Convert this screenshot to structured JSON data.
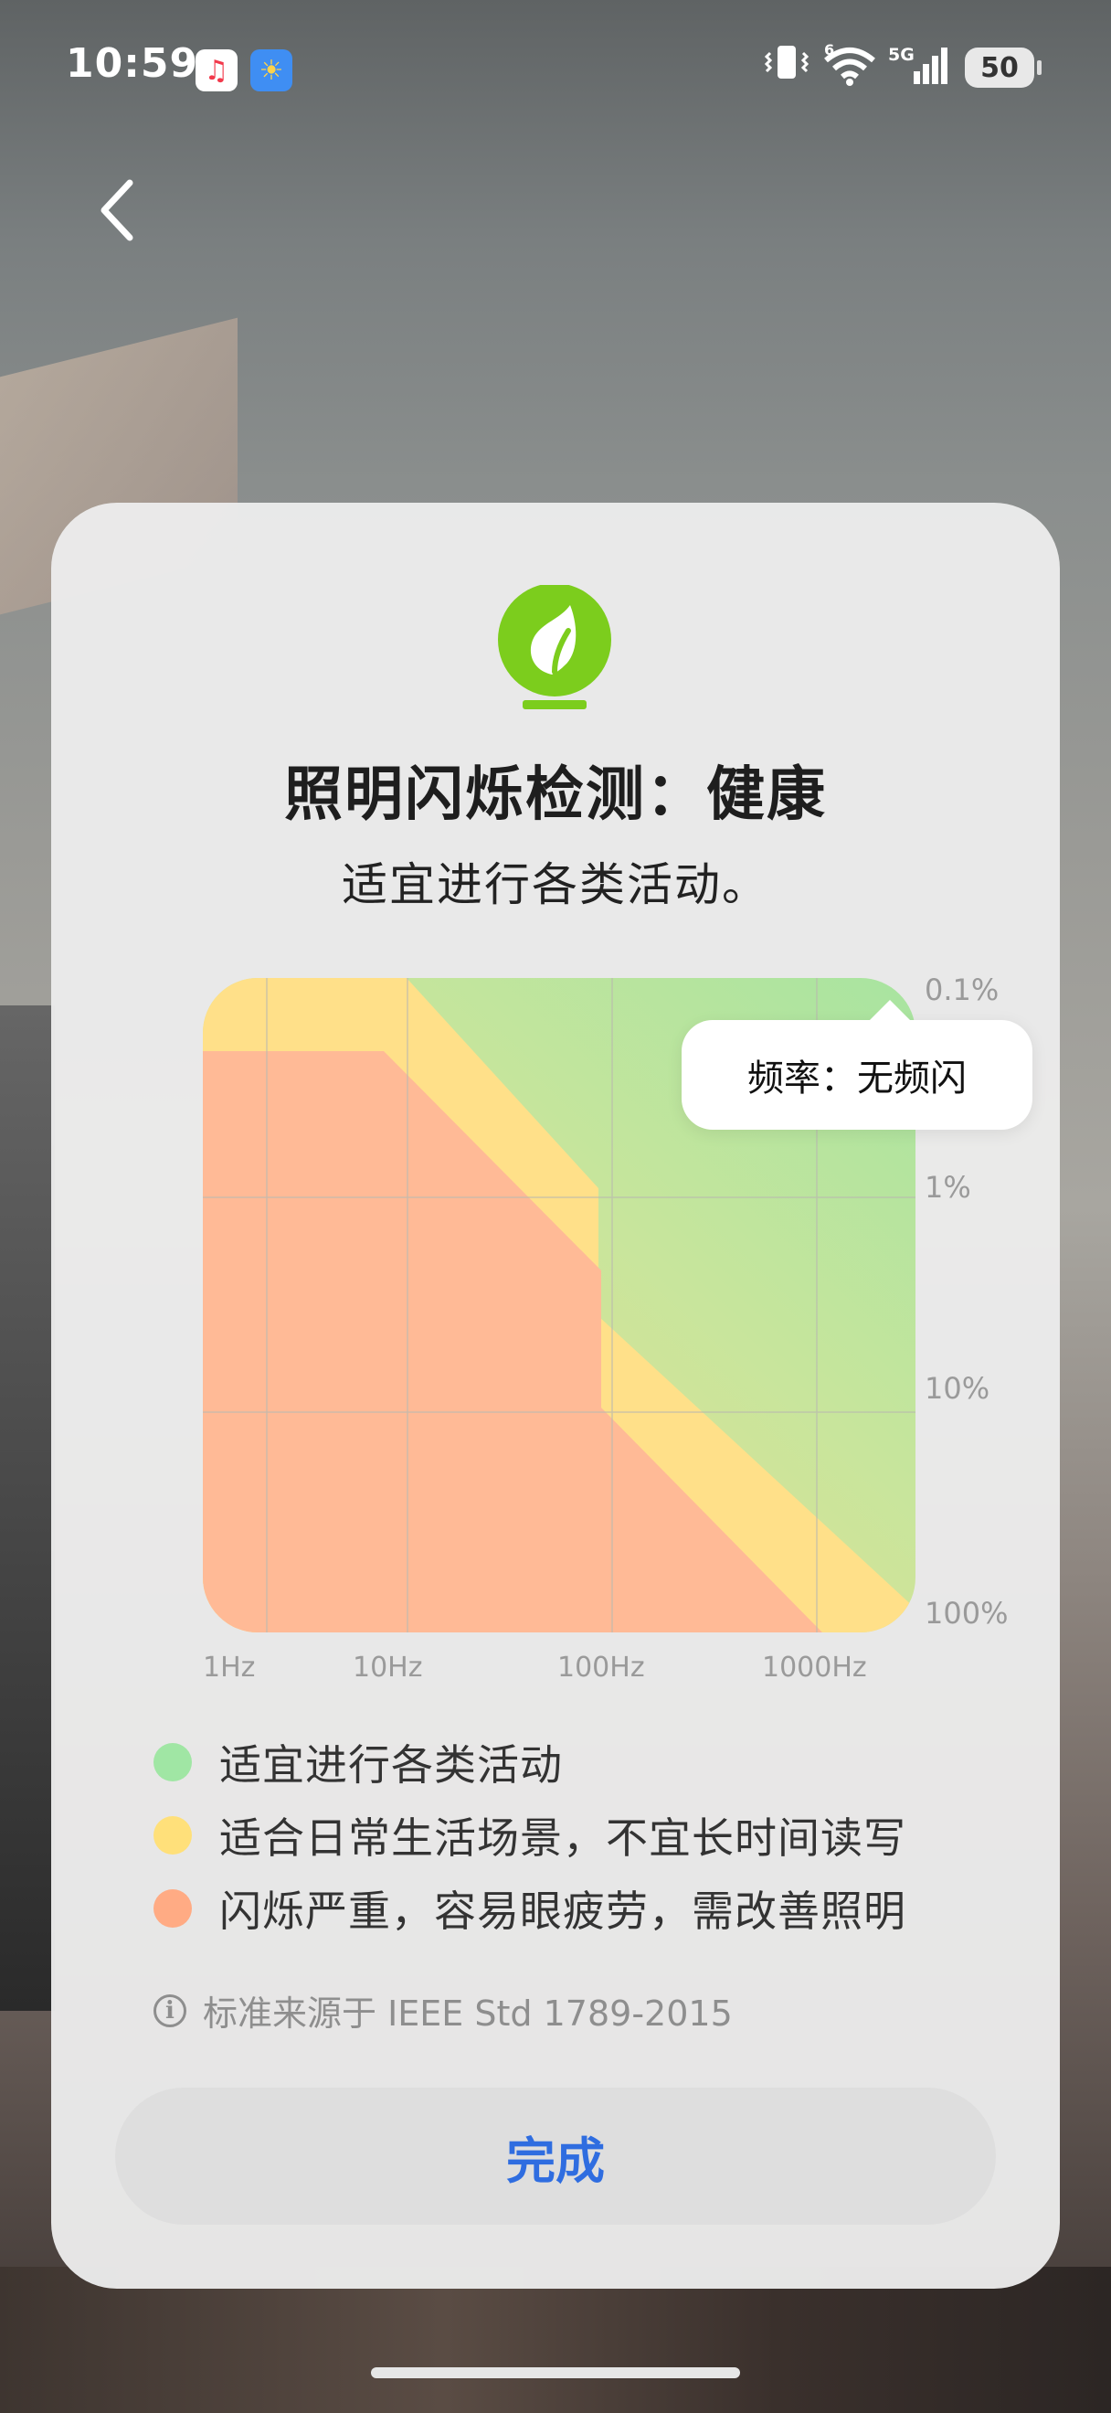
{
  "status_bar": {
    "time": "10:59",
    "app_icons": [
      "music-app-icon",
      "weather-app-icon"
    ],
    "system_icons": [
      "vibrate-icon",
      "wifi-icon",
      "5g-signal-icon"
    ],
    "network": "5G",
    "wifi_badge": "6",
    "battery": "50"
  },
  "header": {
    "back_icon": "chevron-left-icon"
  },
  "card": {
    "icon": "leaf-bulb-icon",
    "icon_color": "#7ccd1d",
    "title": "照明闪烁检测：健康",
    "subtitle": "适宜进行各类活动。",
    "tooltip": "频率：无频闪",
    "legend": [
      {
        "label": "适宜进行各类活动",
        "color": "#a0e6a4"
      },
      {
        "label": "适合日常生活场景，不宜长时间读写",
        "color": "#ffe07a"
      },
      {
        "label": "闪烁严重，容易眼疲劳，需改善照明",
        "color": "#ffab84"
      }
    ],
    "source": "标准来源于 IEEE Std 1789-2015",
    "done_label": "完成"
  },
  "chart_data": {
    "type": "heatmap",
    "x_axis": {
      "scale": "log",
      "tick_labels": [
        "1Hz",
        "10Hz",
        "100Hz",
        "1000Hz"
      ]
    },
    "y_axis": {
      "scale": "log",
      "tick_labels": [
        "0.1%",
        "1%",
        "10%",
        "100%"
      ]
    },
    "zones": [
      "safe",
      "low-risk",
      "high-risk"
    ],
    "zone_colors": {
      "safe": "#a8e4a0",
      "low-risk": "#ffe089",
      "high-risk": "#ffba96"
    },
    "grid": true
  }
}
